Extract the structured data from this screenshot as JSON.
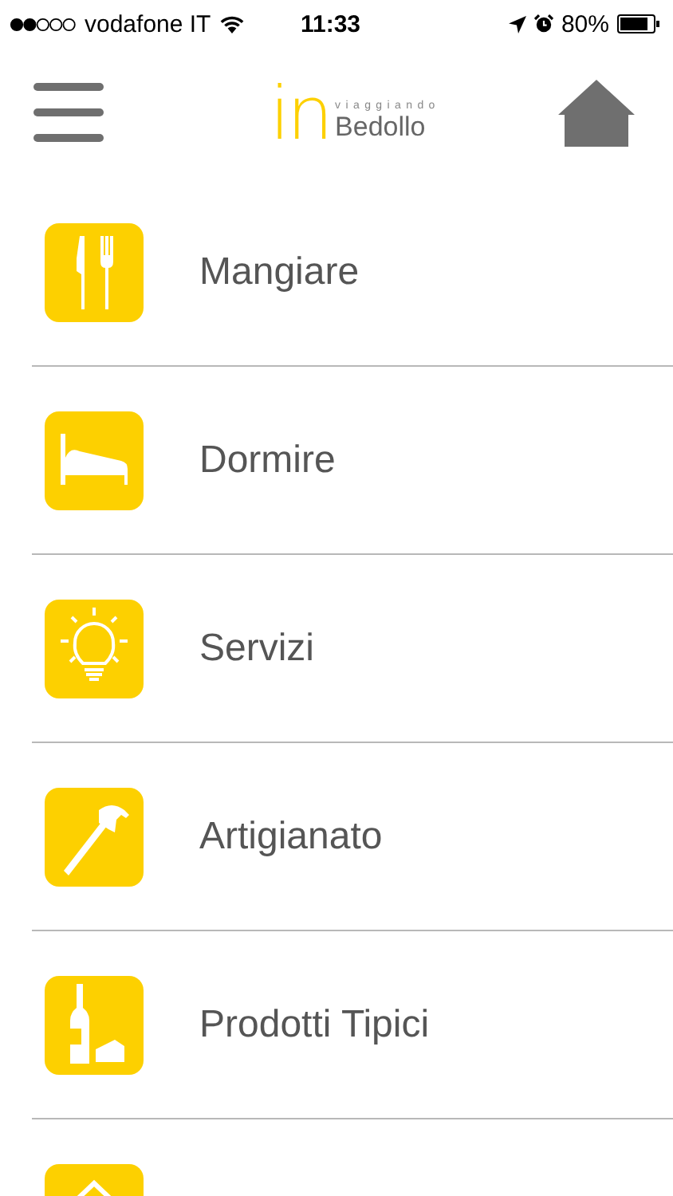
{
  "status_bar": {
    "carrier": "vodafone IT",
    "time": "11:33",
    "battery": "80%"
  },
  "header": {
    "logo": {
      "mark": "in",
      "tagline": "viaggiando",
      "name": "Bedollo"
    }
  },
  "menu": [
    {
      "kind": "food",
      "label": "Mangiare"
    },
    {
      "kind": "bed",
      "label": "Dormire"
    },
    {
      "kind": "bulb",
      "label": "Servizi"
    },
    {
      "kind": "hammer",
      "label": "Artigianato"
    },
    {
      "kind": "wine",
      "label": "Prodotti Tipici"
    },
    {
      "kind": "house"
    }
  ]
}
